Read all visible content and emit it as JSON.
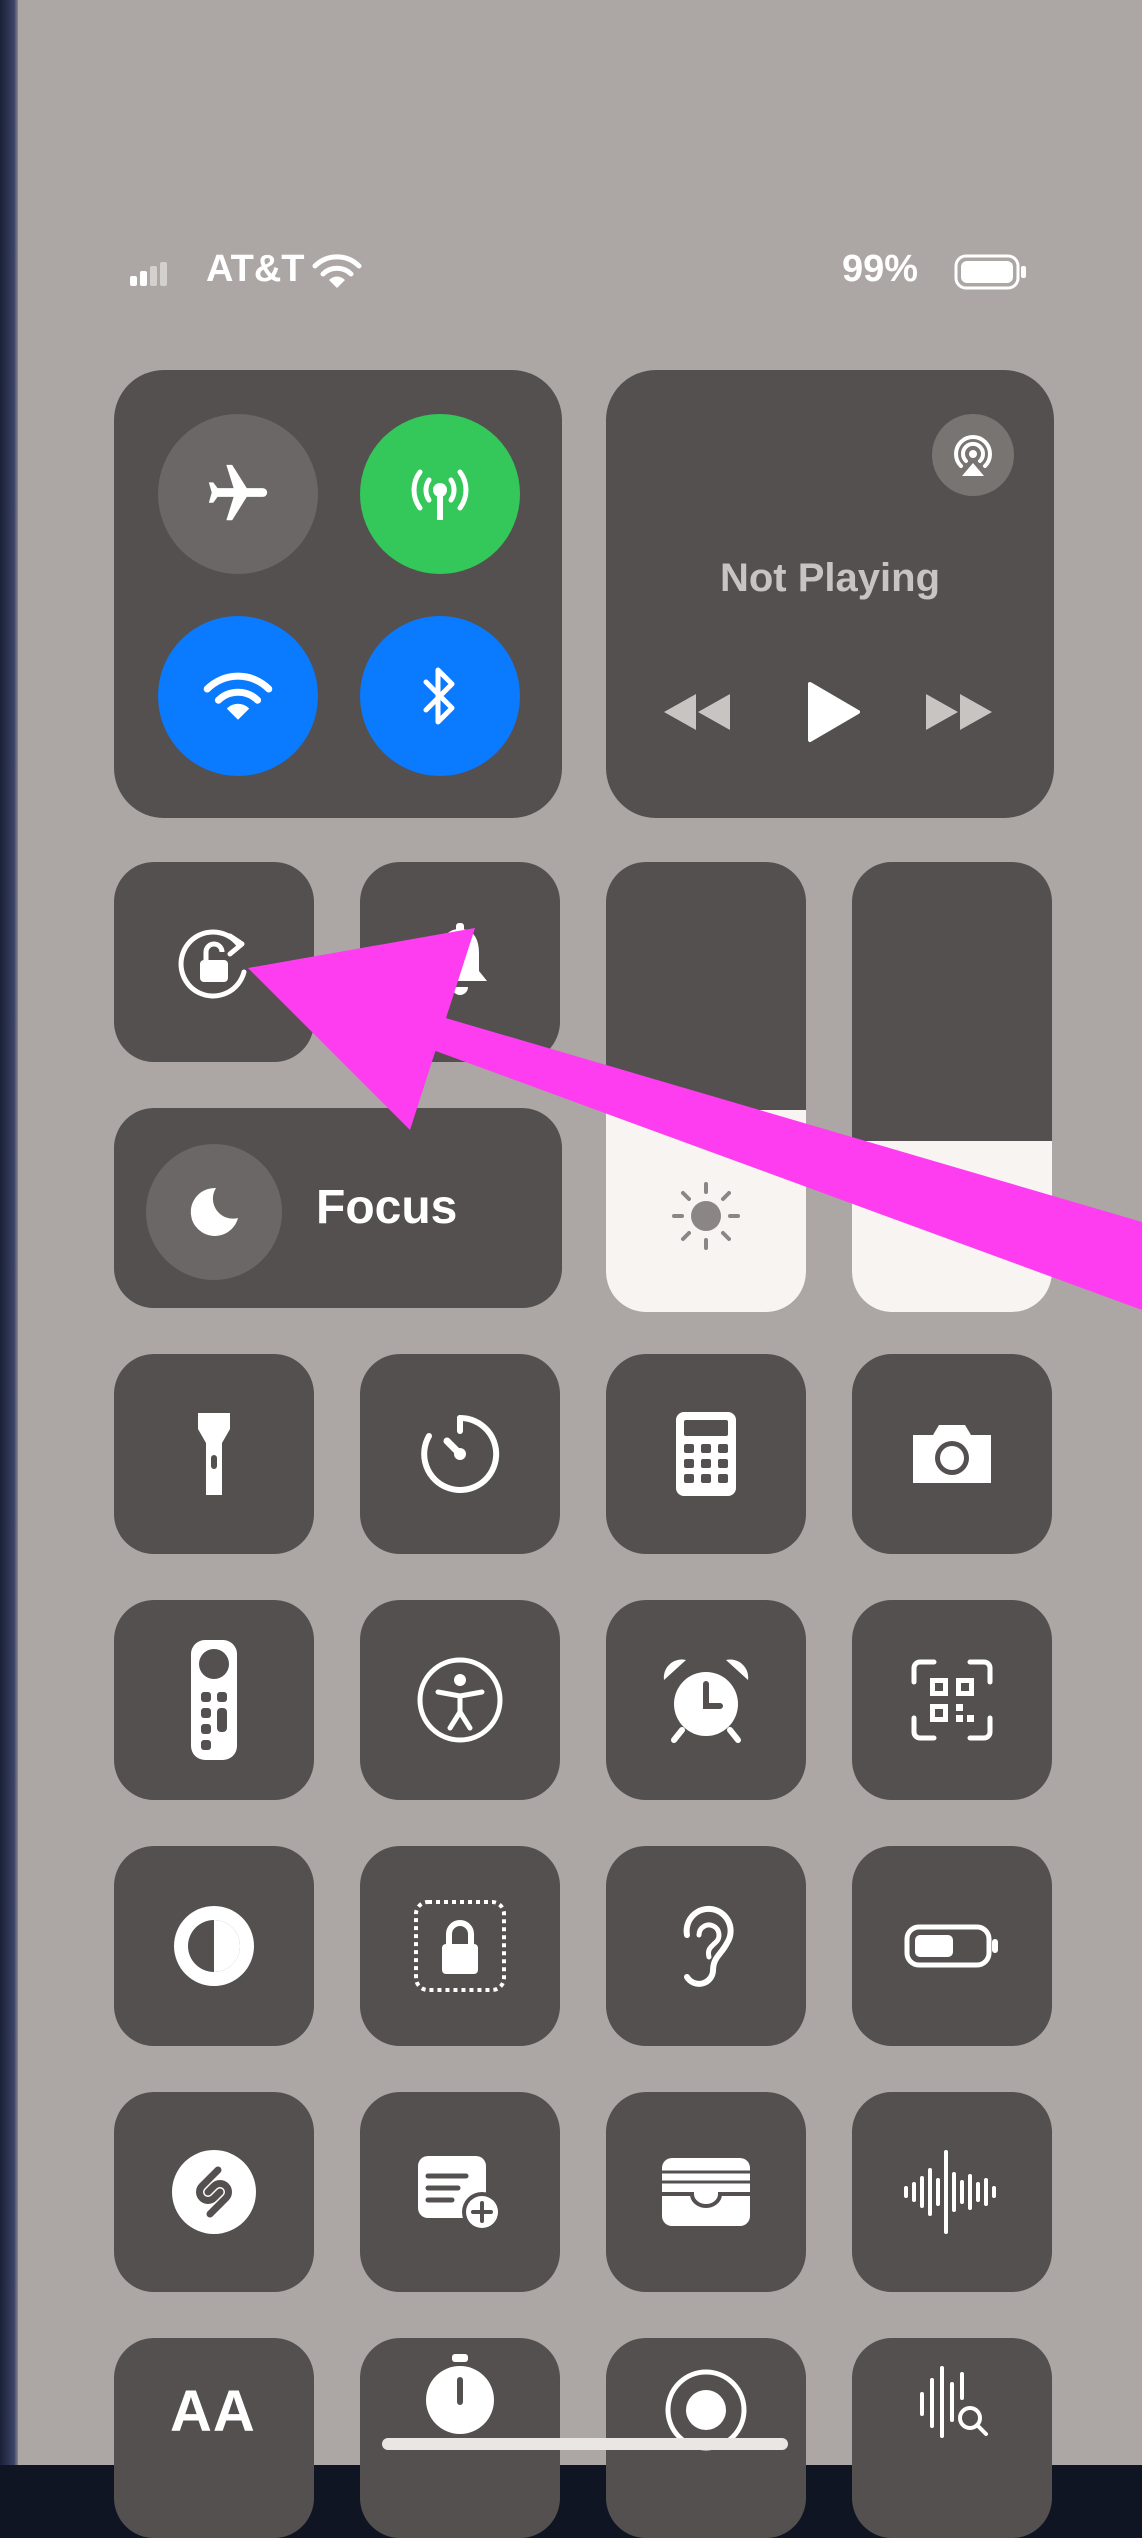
{
  "status_bar": {
    "carrier": "AT&T",
    "battery_percent": "99%",
    "signal_bars_filled": 2,
    "battery_level": 0.99
  },
  "connectivity": {
    "airplane_mode": "off",
    "cellular_data": "on",
    "wifi": "on",
    "bluetooth": "on"
  },
  "now_playing": {
    "status": "Not Playing"
  },
  "focus": {
    "label": "Focus"
  },
  "sliders": {
    "brightness_level": 0.45,
    "volume_level": 0.38
  },
  "colors": {
    "tile": "#545050",
    "background": "#aca7a4",
    "green": "#34c759",
    "blue": "#0a7aff",
    "annotation_arrow": "#ff3df0"
  },
  "controls": [
    "orientation-lock-icon",
    "silent-mode-bell-icon",
    "flashlight-icon",
    "timer-icon",
    "calculator-icon",
    "camera-icon",
    "apple-tv-remote-icon",
    "accessibility-icon",
    "alarm-icon",
    "code-scanner-icon",
    "dark-mode-icon",
    "guided-access-icon",
    "hearing-icon",
    "low-power-mode-icon",
    "shazam-icon",
    "quick-note-icon",
    "wallet-icon",
    "voice-memos-icon",
    "text-size-icon",
    "stopwatch-icon",
    "screen-recording-icon",
    "sound-recognition-icon"
  ],
  "text_size": {
    "label": "AA"
  }
}
